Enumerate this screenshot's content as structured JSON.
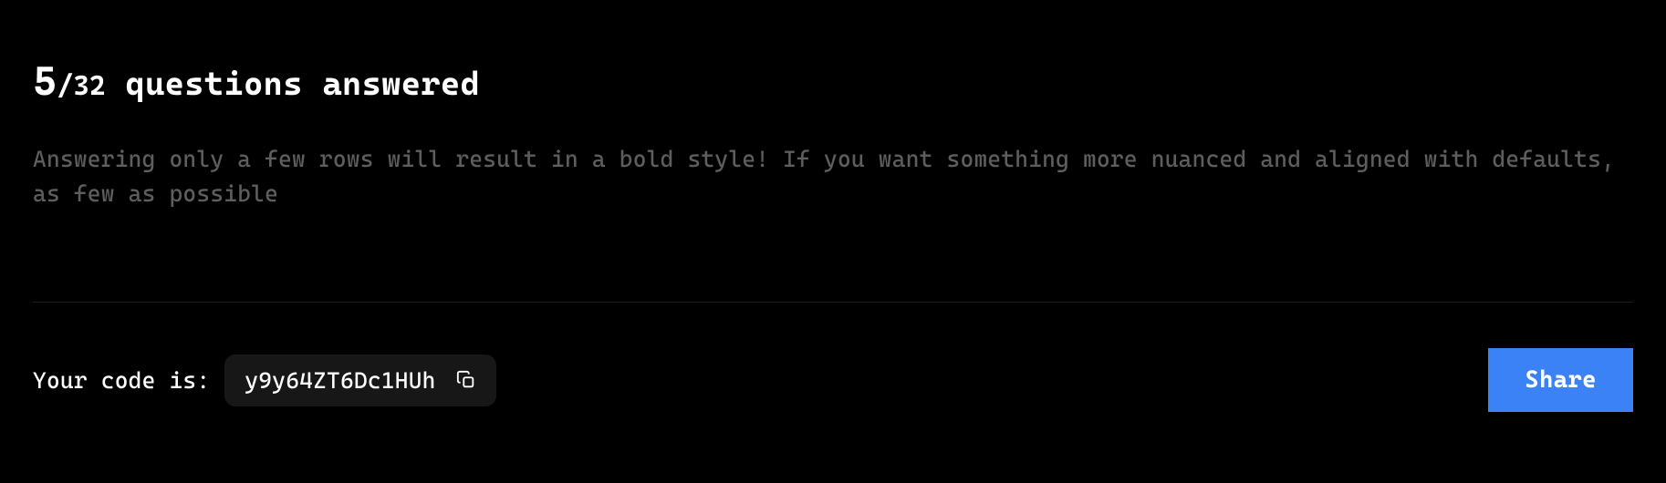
{
  "progress": {
    "current": "5",
    "separator": "/",
    "total": "32",
    "label": "questions answered"
  },
  "description": "Answering only a few rows will result in a bold style! If you want something more nuanced and aligned with defaults, as few as possible",
  "code": {
    "label": "Your code is:",
    "value": "y9y64ZT6Dc1HUh"
  },
  "actions": {
    "share_label": "Share"
  }
}
